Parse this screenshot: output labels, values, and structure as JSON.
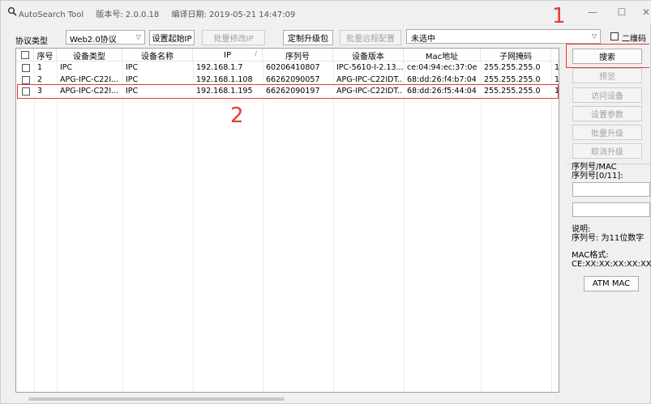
{
  "titlebar": {
    "app_name": "AutoSearch Tool",
    "version": "版本号: 2.0.0.18",
    "build_date": "编译日期: 2019-05-21 14:47:09",
    "min_glyph": "—",
    "max_glyph": "☐",
    "close_glyph": "✕"
  },
  "toolbar": {
    "protocol_label": "协议类型",
    "protocol_value": "Web2.0协议",
    "set_start_ip": "设置起始IP",
    "batch_modify_ip": "批量修改IP",
    "custom_upgrade": "定制升级包",
    "batch_remote_config": "批量远程配置",
    "selection_status": "未选中",
    "qr_label": "二维码",
    "dropdown_glyph": "▽"
  },
  "table": {
    "columns": [
      "序号",
      "设备类型",
      "设备名称",
      "IP",
      "序列号",
      "设备版本",
      "Mac地址",
      "子网掩码"
    ],
    "rows": [
      {
        "no": "1",
        "type": "IPC",
        "name": "IPC",
        "ip": "192.168.1.7",
        "serial": "60206410807",
        "version": "IPC-5610-I-2.13...",
        "mac": "ce:04:94:ec:37:0e",
        "mask": "255.255.255.0",
        "extra": "1"
      },
      {
        "no": "2",
        "type": "APG-IPC-C22I...",
        "name": "IPC",
        "ip": "192.168.1.108",
        "serial": "66262090057",
        "version": "APG-IPC-C22IDT...",
        "mac": "68:dd:26:f4:b7:04",
        "mask": "255.255.255.0",
        "extra": "1"
      },
      {
        "no": "3",
        "type": "APG-IPC-C22I...",
        "name": "IPC",
        "ip": "192.168.1.195",
        "serial": "66262090197",
        "version": "APG-IPC-C22IDT...",
        "mac": "68:dd:26:f5:44:04",
        "mask": "255.255.255.0",
        "extra": "1"
      }
    ]
  },
  "side": {
    "search": "搜索",
    "preview": "预览",
    "visit_device": "访问设备",
    "set_params": "设置参数",
    "batch_upgrade": "批量升级",
    "cancel_upgrade": "取消升级",
    "group_title": "序列号/MAC",
    "serial_count": "序列号[0/11]:",
    "note_title": "说明:",
    "note_serial": "序列号: 为11位数字",
    "mac_format_title": "MAC格式:",
    "mac_format": "CE:XX:XX:XX:XX:XX",
    "atm_mac": "ATM MAC"
  },
  "annotations": {
    "label_1": "1",
    "label_2": "2",
    "color": "#e53935"
  }
}
